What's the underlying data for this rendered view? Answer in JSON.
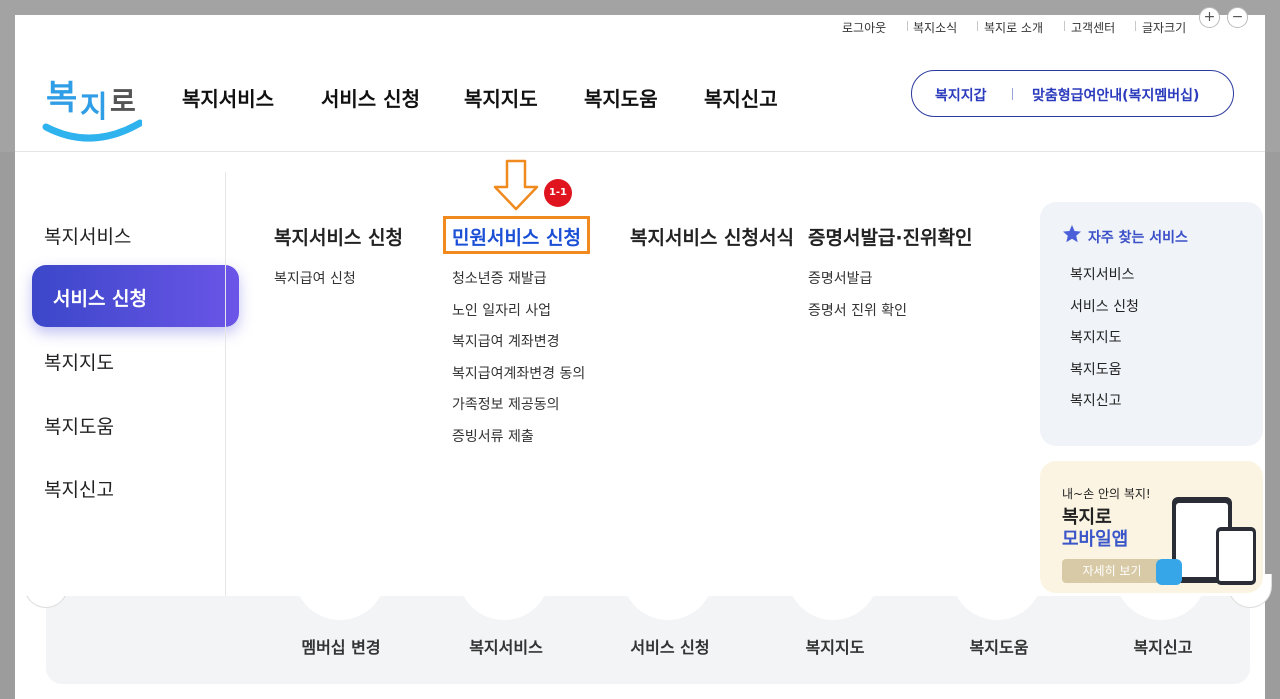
{
  "util_bar": {
    "links": [
      "로그아웃",
      "복지소식",
      "복지로 소개",
      "고객센터",
      "글자크기"
    ],
    "zoom_in": "+",
    "zoom_out": "−"
  },
  "header": {
    "logo_text": "복지로",
    "gnb": [
      "복지서비스",
      "서비스 신청",
      "복지지도",
      "복지도움",
      "복지신고"
    ],
    "pill_links": [
      "복지지갑",
      "맞춤형급여안내(복지멤버십)"
    ]
  },
  "left_menu": {
    "items": [
      "복지서비스",
      "서비스 신청",
      "복지지도",
      "복지도움",
      "복지신고"
    ],
    "active": "서비스 신청"
  },
  "columns": [
    {
      "title": "복지서비스 신청",
      "items": [
        "복지급여 신청"
      ]
    },
    {
      "title": "민원서비스 신청",
      "items": [
        "청소년증 재발급",
        "노인 일자리 사업",
        "복지급여 계좌변경",
        "복지급여계좌변경 동의",
        "가족정보 제공동의",
        "증빙서류 제출"
      ]
    },
    {
      "title": "복지서비스 신청서식",
      "items": []
    },
    {
      "title": "증명서발급·진위확인",
      "items": [
        "증명서발급",
        "증명서 진위 확인"
      ]
    }
  ],
  "annotation": {
    "badge": "1-1",
    "arrow_color": "#f08a1e",
    "box_color": "#f08a1e",
    "badge_color": "#e0141e"
  },
  "favorites": {
    "title": "자주 찾는 서비스",
    "items": [
      "복지서비스",
      "서비스 신청",
      "복지지도",
      "복지도움",
      "복지신고"
    ]
  },
  "app_banner": {
    "small": "내~손 안의 복지!",
    "title1": "복지로",
    "title2": "모바일앱",
    "button": "자세히 보기"
  },
  "background_quick_menu": [
    "멤버십 변경",
    "복지서비스",
    "서비스 신청",
    "복지지도",
    "복지도움",
    "복지신고"
  ],
  "colors": {
    "accent": "#1b4fd6",
    "active_gradient_start": "#3b47c9",
    "active_gradient_end": "#6b55e8"
  }
}
